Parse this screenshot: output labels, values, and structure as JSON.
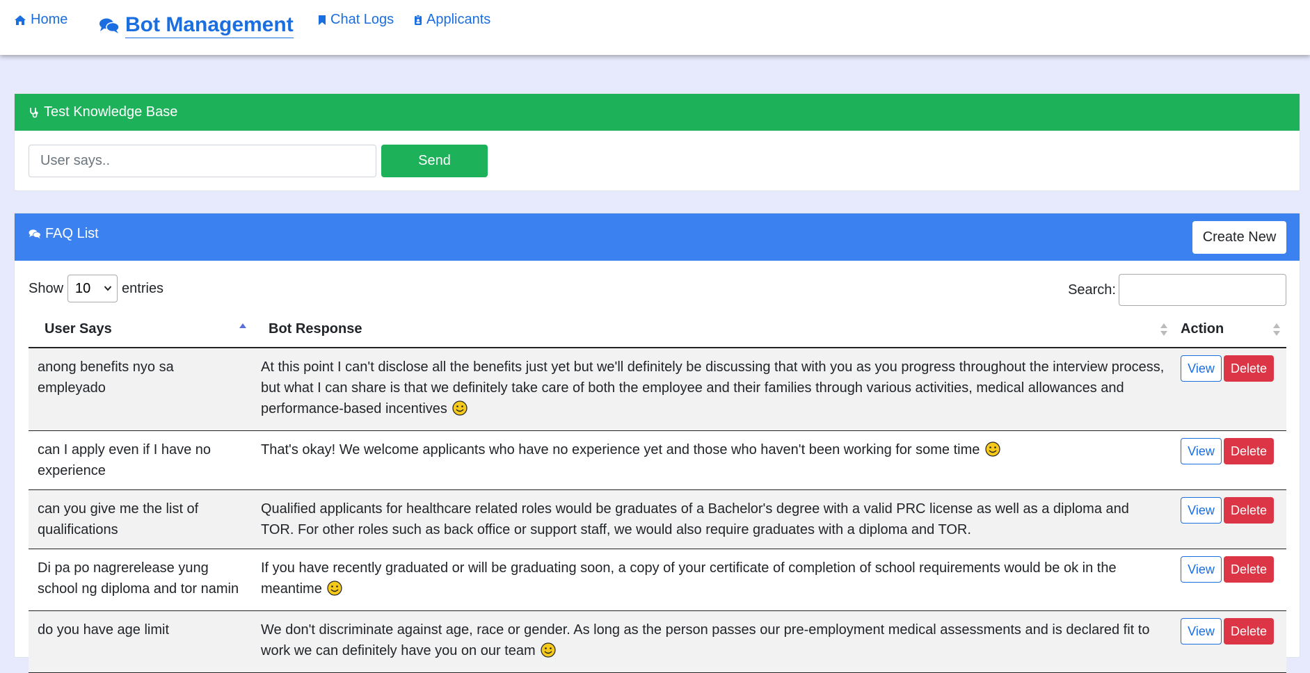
{
  "nav": {
    "home_label": "Home",
    "brand_label": "Bot Management",
    "chatlogs_label": "Chat Logs",
    "applicants_label": "Applicants"
  },
  "kb": {
    "title": "Test Knowledge Base",
    "input_placeholder": "User says..",
    "send_label": "Send"
  },
  "faq": {
    "title": "FAQ List",
    "create_label": "Create New",
    "show_label": "Show",
    "entries_label": "entries",
    "page_size": "10",
    "search_label": "Search:",
    "columns": [
      "User Says",
      "Bot Response",
      "Action"
    ],
    "view_label": "View",
    "delete_label": "Delete",
    "rows": [
      {
        "user": "anong benefits nyo sa empleyado",
        "response": "At this point I can't disclose all the benefits just yet but we'll definitely be discussing that with you as you progress throughout the interview process, but what I can share is that we definitely take care of both the employee and their families through various activities, medical allowances and performance-based incentives",
        "emoji": true
      },
      {
        "user": "can I apply even if I have no experience",
        "response": "That's okay! We welcome applicants who have no experience yet and those who haven't been working for some time",
        "emoji": true
      },
      {
        "user": "can you give me the list of qualifications",
        "response": "Qualified applicants for healthcare related roles would be graduates of a Bachelor's degree with a valid PRC license as well as a diploma and TOR. For other roles such as back office or support staff, we would also require graduates with a diploma and TOR.",
        "emoji": false
      },
      {
        "user": "Di pa po nagrerelease yung school ng diploma and tor namin",
        "response": "If you have recently graduated or will be graduating soon, a copy of your certificate of completion of school requirements would be ok in the meantime",
        "emoji": true
      },
      {
        "user": "do you have age limit",
        "response": "We don't discriminate against age, race or gender. As long as the person passes our pre-employment medical assessments and is declared fit to work we can definitely have you on our team",
        "emoji": true
      }
    ]
  },
  "colors": {
    "link": "#1a6ee0",
    "kb_header": "#1db15a",
    "faq_header": "#3b82f0",
    "delete": "#dc3545",
    "page_bg": "#e6eafc"
  }
}
